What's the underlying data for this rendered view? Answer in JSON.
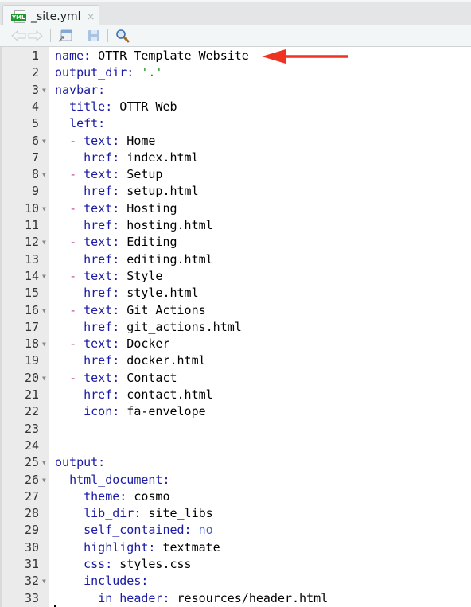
{
  "tab": {
    "title": "_site.yml",
    "file_badge": "YML",
    "close_glyph": "×"
  },
  "toolbar": {
    "icons": [
      "back-arrow-icon",
      "forward-arrow-icon",
      "show-in-window-icon",
      "save-icon",
      "search-icon"
    ]
  },
  "annotation": {
    "type": "red-arrow",
    "color": "#ee3322",
    "points_to_line": 1
  },
  "colors": {
    "key": "#1a1aa6",
    "string": "#1e8a1e",
    "dash": "#c24fa6",
    "boolean": "#4060d8"
  },
  "lines": [
    {
      "n": "1",
      "fold": false,
      "segs": [
        [
          "k",
          "name:"
        ],
        [
          "t",
          " OTTR Template Website"
        ]
      ]
    },
    {
      "n": "2",
      "fold": false,
      "segs": [
        [
          "k",
          "output_dir:"
        ],
        [
          "t",
          " "
        ],
        [
          "s",
          "'.'"
        ]
      ]
    },
    {
      "n": "3",
      "fold": true,
      "segs": [
        [
          "k",
          "navbar:"
        ]
      ]
    },
    {
      "n": "4",
      "fold": false,
      "segs": [
        [
          "t",
          "  "
        ],
        [
          "k",
          "title:"
        ],
        [
          "t",
          " OTTR Web"
        ]
      ]
    },
    {
      "n": "5",
      "fold": false,
      "segs": [
        [
          "t",
          "  "
        ],
        [
          "k",
          "left:"
        ]
      ]
    },
    {
      "n": "6",
      "fold": true,
      "segs": [
        [
          "t",
          "  "
        ],
        [
          "d",
          "-"
        ],
        [
          "t",
          " "
        ],
        [
          "k",
          "text:"
        ],
        [
          "t",
          " Home"
        ]
      ]
    },
    {
      "n": "7",
      "fold": false,
      "segs": [
        [
          "t",
          "    "
        ],
        [
          "k",
          "href:"
        ],
        [
          "t",
          " index.html"
        ]
      ]
    },
    {
      "n": "8",
      "fold": true,
      "segs": [
        [
          "t",
          "  "
        ],
        [
          "d",
          "-"
        ],
        [
          "t",
          " "
        ],
        [
          "k",
          "text:"
        ],
        [
          "t",
          " Setup"
        ]
      ]
    },
    {
      "n": "9",
      "fold": false,
      "segs": [
        [
          "t",
          "    "
        ],
        [
          "k",
          "href:"
        ],
        [
          "t",
          " setup.html"
        ]
      ]
    },
    {
      "n": "10",
      "fold": true,
      "segs": [
        [
          "t",
          "  "
        ],
        [
          "d",
          "-"
        ],
        [
          "t",
          " "
        ],
        [
          "k",
          "text:"
        ],
        [
          "t",
          " Hosting"
        ]
      ]
    },
    {
      "n": "11",
      "fold": false,
      "segs": [
        [
          "t",
          "    "
        ],
        [
          "k",
          "href:"
        ],
        [
          "t",
          " hosting.html"
        ]
      ]
    },
    {
      "n": "12",
      "fold": true,
      "segs": [
        [
          "t",
          "  "
        ],
        [
          "d",
          "-"
        ],
        [
          "t",
          " "
        ],
        [
          "k",
          "text:"
        ],
        [
          "t",
          " Editing"
        ]
      ]
    },
    {
      "n": "13",
      "fold": false,
      "segs": [
        [
          "t",
          "    "
        ],
        [
          "k",
          "href:"
        ],
        [
          "t",
          " editing.html"
        ]
      ]
    },
    {
      "n": "14",
      "fold": true,
      "segs": [
        [
          "t",
          "  "
        ],
        [
          "d",
          "-"
        ],
        [
          "t",
          " "
        ],
        [
          "k",
          "text:"
        ],
        [
          "t",
          " Style"
        ]
      ]
    },
    {
      "n": "15",
      "fold": false,
      "segs": [
        [
          "t",
          "    "
        ],
        [
          "k",
          "href:"
        ],
        [
          "t",
          " style.html"
        ]
      ]
    },
    {
      "n": "16",
      "fold": true,
      "segs": [
        [
          "t",
          "  "
        ],
        [
          "d",
          "-"
        ],
        [
          "t",
          " "
        ],
        [
          "k",
          "text:"
        ],
        [
          "t",
          " Git Actions"
        ]
      ]
    },
    {
      "n": "17",
      "fold": false,
      "segs": [
        [
          "t",
          "    "
        ],
        [
          "k",
          "href:"
        ],
        [
          "t",
          " git_actions.html"
        ]
      ]
    },
    {
      "n": "18",
      "fold": true,
      "segs": [
        [
          "t",
          "  "
        ],
        [
          "d",
          "-"
        ],
        [
          "t",
          " "
        ],
        [
          "k",
          "text:"
        ],
        [
          "t",
          " Docker"
        ]
      ]
    },
    {
      "n": "19",
      "fold": false,
      "segs": [
        [
          "t",
          "    "
        ],
        [
          "k",
          "href:"
        ],
        [
          "t",
          " docker.html"
        ]
      ]
    },
    {
      "n": "20",
      "fold": true,
      "segs": [
        [
          "t",
          "  "
        ],
        [
          "d",
          "-"
        ],
        [
          "t",
          " "
        ],
        [
          "k",
          "text:"
        ],
        [
          "t",
          " Contact"
        ]
      ]
    },
    {
      "n": "21",
      "fold": false,
      "segs": [
        [
          "t",
          "    "
        ],
        [
          "k",
          "href:"
        ],
        [
          "t",
          " contact.html"
        ]
      ]
    },
    {
      "n": "22",
      "fold": false,
      "segs": [
        [
          "t",
          "    "
        ],
        [
          "k",
          "icon:"
        ],
        [
          "t",
          " fa-envelope"
        ]
      ]
    },
    {
      "n": "23",
      "fold": false,
      "segs": []
    },
    {
      "n": "24",
      "fold": false,
      "segs": []
    },
    {
      "n": "25",
      "fold": true,
      "segs": [
        [
          "k",
          "output:"
        ]
      ]
    },
    {
      "n": "26",
      "fold": true,
      "segs": [
        [
          "t",
          "  "
        ],
        [
          "k",
          "html_document:"
        ]
      ]
    },
    {
      "n": "27",
      "fold": false,
      "segs": [
        [
          "t",
          "    "
        ],
        [
          "k",
          "theme:"
        ],
        [
          "t",
          " cosmo"
        ]
      ]
    },
    {
      "n": "28",
      "fold": false,
      "segs": [
        [
          "t",
          "    "
        ],
        [
          "k",
          "lib_dir:"
        ],
        [
          "t",
          " site_libs"
        ]
      ]
    },
    {
      "n": "29",
      "fold": false,
      "segs": [
        [
          "t",
          "    "
        ],
        [
          "k",
          "self_contained:"
        ],
        [
          "t",
          " "
        ],
        [
          "b",
          "no"
        ]
      ]
    },
    {
      "n": "30",
      "fold": false,
      "segs": [
        [
          "t",
          "    "
        ],
        [
          "k",
          "highlight:"
        ],
        [
          "t",
          " textmate"
        ]
      ]
    },
    {
      "n": "31",
      "fold": false,
      "segs": [
        [
          "t",
          "    "
        ],
        [
          "k",
          "css:"
        ],
        [
          "t",
          " styles.css"
        ]
      ]
    },
    {
      "n": "32",
      "fold": true,
      "segs": [
        [
          "t",
          "    "
        ],
        [
          "k",
          "includes:"
        ]
      ]
    },
    {
      "n": "33",
      "fold": false,
      "segs": [
        [
          "t",
          "      "
        ],
        [
          "k",
          "in_header:"
        ],
        [
          "t",
          " resources/header.html"
        ]
      ]
    }
  ]
}
